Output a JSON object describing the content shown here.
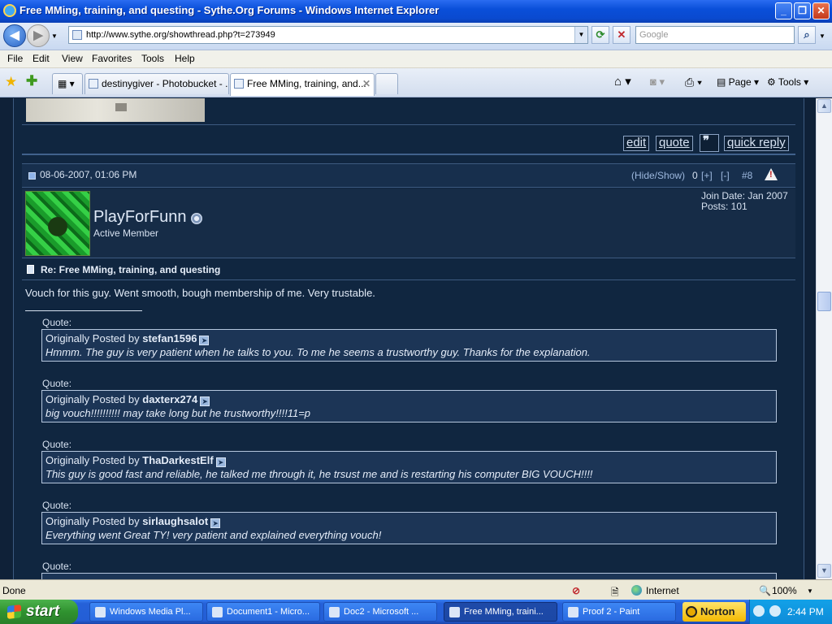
{
  "window": {
    "title": "Free MMing, training, and questing - Sythe.Org Forums - Windows Internet Explorer",
    "minimize": "_",
    "maximize": "❐",
    "close": "✕"
  },
  "nav": {
    "back": "◀",
    "forward": "▶",
    "url": "http://www.sythe.org/showthread.php?t=273949",
    "refresh": "⟳",
    "stop": "✕",
    "search_placeholder": "Google",
    "search_button": "⌕"
  },
  "menu": [
    "File",
    "Edit",
    "View",
    "Favorites",
    "Tools",
    "Help"
  ],
  "tabs": [
    {
      "label": "destinygiver - Photobucket - ..."
    },
    {
      "label": "Free MMing, training, and..."
    }
  ],
  "toolbar": {
    "page": "Page",
    "tools": "Tools"
  },
  "post_actions": {
    "edit": "edit",
    "quote": "quote",
    "quick_reply": "quick reply"
  },
  "post": {
    "date": "08-06-2007, 01:06 PM",
    "hide_show": "(Hide/Show)",
    "rep_count": "0",
    "rep_plus": "[+]",
    "rep_minus": "[-]",
    "number": "#8",
    "username": "PlayForFunn",
    "user_title": "Active Member",
    "join_date": "Join Date: Jan 2007",
    "posts": "Posts: 101",
    "title": "Re: Free MMing, training, and questing",
    "body": "Vouch for this guy. Went smooth, bough membership of me. Very trustable."
  },
  "quotes": [
    {
      "label": "Quote:",
      "prefix": "Originally Posted by",
      "author": "stefan1596",
      "text": "Hmmm. The guy is very patient when he talks to you. To me he seems a trustworthy guy. Thanks for the explanation."
    },
    {
      "label": "Quote:",
      "prefix": "Originally Posted by",
      "author": "daxterx274",
      "text": "big vouch!!!!!!!!!! may take long but he trustworthy!!!!11=p"
    },
    {
      "label": "Quote:",
      "prefix": "Originally Posted by",
      "author": "ThaDarkestElf",
      "text": "This guy is good fast and reliable, he talked me through it, he trsust me and is restarting his computer BIG VOUCH!!!!"
    },
    {
      "label": "Quote:",
      "prefix": "Originally Posted by",
      "author": "sirlaughsalot",
      "text": "Everything went Great TY! very patient and explained everything vouch!"
    },
    {
      "label": "Quote:"
    }
  ],
  "status": {
    "text": "Done",
    "zone": "Internet",
    "zoom": "100%"
  },
  "taskbar": {
    "start": "start",
    "items": [
      {
        "label": "Windows Media Pl..."
      },
      {
        "label": "Document1 - Micro..."
      },
      {
        "label": "Doc2 - Microsoft ..."
      },
      {
        "label": "Free MMing, traini..."
      },
      {
        "label": "Proof 2 - Paint"
      }
    ],
    "norton": "Norton",
    "clock": "2:44 PM"
  }
}
